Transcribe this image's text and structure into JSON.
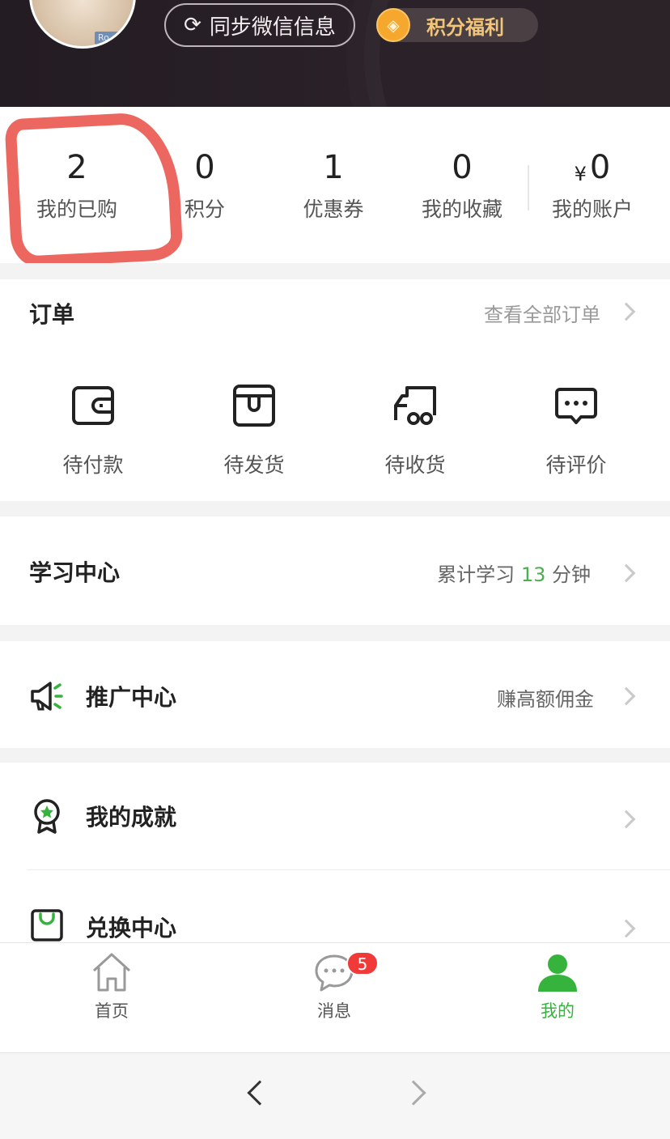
{
  "header": {
    "sync_label": "同步微信信息",
    "points_label": "积分福利",
    "avatar_tag": "Ro"
  },
  "stats": [
    {
      "value": "2",
      "label": "我的已购"
    },
    {
      "value": "0",
      "label": "积分"
    },
    {
      "value": "1",
      "label": "优惠券"
    },
    {
      "value": "0",
      "label": "我的收藏"
    },
    {
      "currency": "¥",
      "value": "0",
      "label": "我的账户"
    }
  ],
  "orders": {
    "title": "订单",
    "view_all": "查看全部订单",
    "items": [
      {
        "label": "待付款",
        "icon": "wallet-icon"
      },
      {
        "label": "待发货",
        "icon": "box-icon"
      },
      {
        "label": "待收货",
        "icon": "truck-icon"
      },
      {
        "label": "待评价",
        "icon": "comment-icon"
      }
    ]
  },
  "study": {
    "title": "学习中心",
    "prefix": "累计学习",
    "minutes": "13",
    "suffix": "分钟"
  },
  "promote": {
    "title": "推广中心",
    "subtitle": "赚高额佣金",
    "icon": "megaphone-icon"
  },
  "achievement": {
    "title": "我的成就",
    "icon": "medal-icon"
  },
  "exchange": {
    "title": "兑换中心",
    "icon": "shopping-bag-icon"
  },
  "tabs": [
    {
      "label": "首页",
      "icon": "home-icon"
    },
    {
      "label": "消息",
      "icon": "chat-icon",
      "badge": "5"
    },
    {
      "label": "我的",
      "icon": "user-icon",
      "active": true
    }
  ],
  "colors": {
    "accent_green": "#36b33d",
    "badge_red": "#f03a3a",
    "points_gold": "#f2c67a",
    "annotation_red": "#e8463c"
  }
}
